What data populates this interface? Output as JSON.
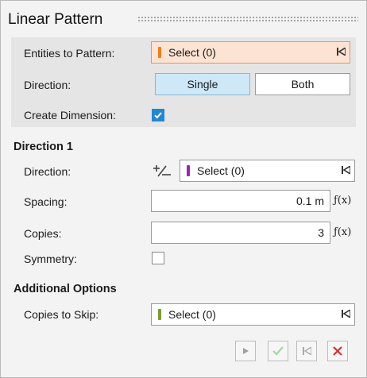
{
  "title": "Linear Pattern",
  "rows": {
    "entities_label": "Entities to Pattern:",
    "entities_select": "Select (0)",
    "direction_label": "Direction:",
    "direction_options": [
      "Single",
      "Both"
    ],
    "direction_selected": "Single",
    "create_dimension_label": "Create Dimension:",
    "create_dimension_checked": true
  },
  "direction1": {
    "heading": "Direction 1",
    "direction_label": "Direction:",
    "direction_select": "Select (0)",
    "spacing_label": "Spacing:",
    "spacing_value": "0.1 m",
    "copies_label": "Copies:",
    "copies_value": "3",
    "symmetry_label": "Symmetry:",
    "symmetry_checked": false,
    "fx_label": "ƒ(x)"
  },
  "additional": {
    "heading": "Additional Options",
    "skip_label": "Copies to Skip:",
    "skip_select": "Select (0)"
  },
  "colors": {
    "entities_bar": "#f07d1a",
    "direction_bar": "#9b27b0",
    "skip_bar": "#7f9a2e",
    "accent": "#1e88d6",
    "cancel": "#d9302f",
    "ok": "#6cc36a"
  },
  "icons": {
    "end_marker": "⏮",
    "direction_flip": "plus-minus-icon"
  }
}
